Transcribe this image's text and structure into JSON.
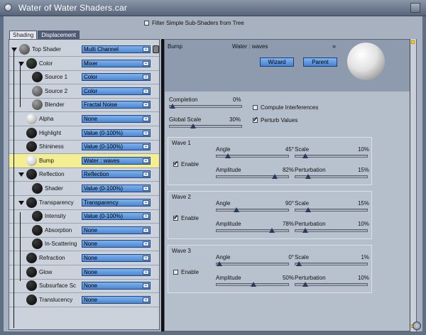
{
  "window": {
    "title": "Water of Water Shaders.car"
  },
  "filter": {
    "label": "Filter Simple Sub-Shaders from Tree",
    "checked": false
  },
  "tabs": [
    {
      "label": "Shading",
      "active": true
    },
    {
      "label": "Displacement",
      "active": false
    }
  ],
  "tree": [
    {
      "label": "Top Shader",
      "value": "Multi Channel"
    },
    {
      "label": "Color",
      "value": "Mixer"
    },
    {
      "label": "Source 1",
      "value": "Color"
    },
    {
      "label": "Source 2",
      "value": "Color"
    },
    {
      "label": "Blender",
      "value": "Fractal Noise"
    },
    {
      "label": "Alpha",
      "value": "None"
    },
    {
      "label": "Highlight",
      "value": "Value (0-100%)"
    },
    {
      "label": "Shininess",
      "value": "Value (0-100%)"
    },
    {
      "label": "Bump",
      "value": "Water : waves"
    },
    {
      "label": "Reflection",
      "value": "Reflection"
    },
    {
      "label": "Shader",
      "value": "Value (0-100%)"
    },
    {
      "label": "Transparency",
      "value": "Transparency"
    },
    {
      "label": "Intensity",
      "value": "Value (0-100%)"
    },
    {
      "label": "Absorption",
      "value": "None"
    },
    {
      "label": "In-Scattering",
      "value": "None"
    },
    {
      "label": "Refraction",
      "value": "None"
    },
    {
      "label": "Glow",
      "value": "None"
    },
    {
      "label": "Subsurface Sc",
      "value": "None"
    },
    {
      "label": "Translucency",
      "value": "None"
    }
  ],
  "right": {
    "channel": "Bump",
    "shader": "Water : waves",
    "wizard": "Wizard",
    "parent": "Parent",
    "completion": {
      "label": "Completion",
      "value": "0%",
      "fraction": 0
    },
    "global_scale": {
      "label": "Global Scale",
      "value": "30%",
      "fraction": 0.3
    },
    "compute_interferences": {
      "label": "Compute Interferences",
      "checked": false
    },
    "perturb_values": {
      "label": "Perturb Values",
      "checked": true
    },
    "enable_label": "Enable",
    "labels": {
      "angle": "Angle",
      "scale": "Scale",
      "amplitude": "Amplitude",
      "perturbation": "Perturbation"
    },
    "waves": [
      {
        "title": "Wave 1",
        "enabled": true,
        "angle": {
          "value": "45°",
          "fraction": 0.125
        },
        "scale": {
          "value": "10%",
          "fraction": 0.1
        },
        "amplitude": {
          "value": "82%",
          "fraction": 0.82
        },
        "perturbation": {
          "value": "15%",
          "fraction": 0.15
        }
      },
      {
        "title": "Wave 2",
        "enabled": true,
        "angle": {
          "value": "90°",
          "fraction": 0.25
        },
        "scale": {
          "value": "15%",
          "fraction": 0.15
        },
        "amplitude": {
          "value": "78%",
          "fraction": 0.78
        },
        "perturbation": {
          "value": "10%",
          "fraction": 0.1
        }
      },
      {
        "title": "Wave 3",
        "enabled": false,
        "angle": {
          "value": "0°",
          "fraction": 0
        },
        "scale": {
          "value": "1%",
          "fraction": 0.01
        },
        "amplitude": {
          "value": "50%",
          "fraction": 0.5
        },
        "perturbation": {
          "value": "10%",
          "fraction": 0.1
        }
      }
    ]
  }
}
